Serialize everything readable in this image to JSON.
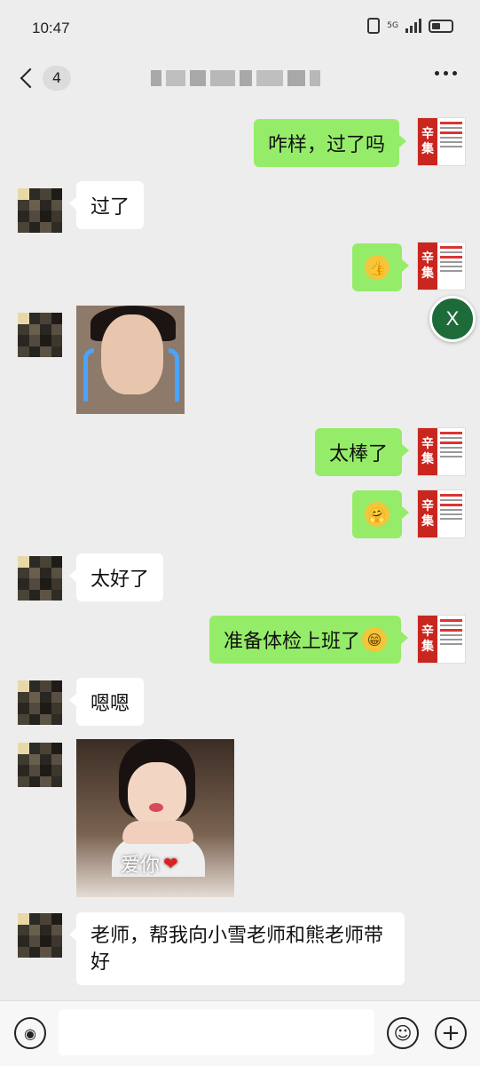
{
  "status_bar": {
    "time": "10:47",
    "network": "5G"
  },
  "header": {
    "unread_count": "4",
    "more_label": "more"
  },
  "messages": [
    {
      "side": "out",
      "text": "咋样，过了吗"
    },
    {
      "side": "in",
      "text": "过了"
    },
    {
      "side": "out",
      "emoji": "👍"
    },
    {
      "side": "in",
      "sticker": "crying-face-sticker"
    },
    {
      "side": "out",
      "text": "太棒了"
    },
    {
      "side": "out",
      "emoji": "🤗"
    },
    {
      "side": "in",
      "text": "太好了"
    },
    {
      "side": "out",
      "text": "准备体检上班了",
      "emoji": "😁"
    },
    {
      "side": "in",
      "text": "嗯嗯"
    },
    {
      "side": "in",
      "sticker": "girl-kiss-sticker",
      "caption": "爱你"
    },
    {
      "side": "in",
      "text": "老师，帮我向小雪老师和熊老师带好"
    }
  ],
  "self_avatar": {
    "char1": "辛",
    "char2": "集"
  },
  "close_fab": {
    "label": "X"
  },
  "input": {
    "placeholder": ""
  },
  "colors": {
    "outgoing_bubble": "#95ec69",
    "incoming_bubble": "#ffffff",
    "background": "#ededed",
    "fab": "#1e6b3a"
  }
}
